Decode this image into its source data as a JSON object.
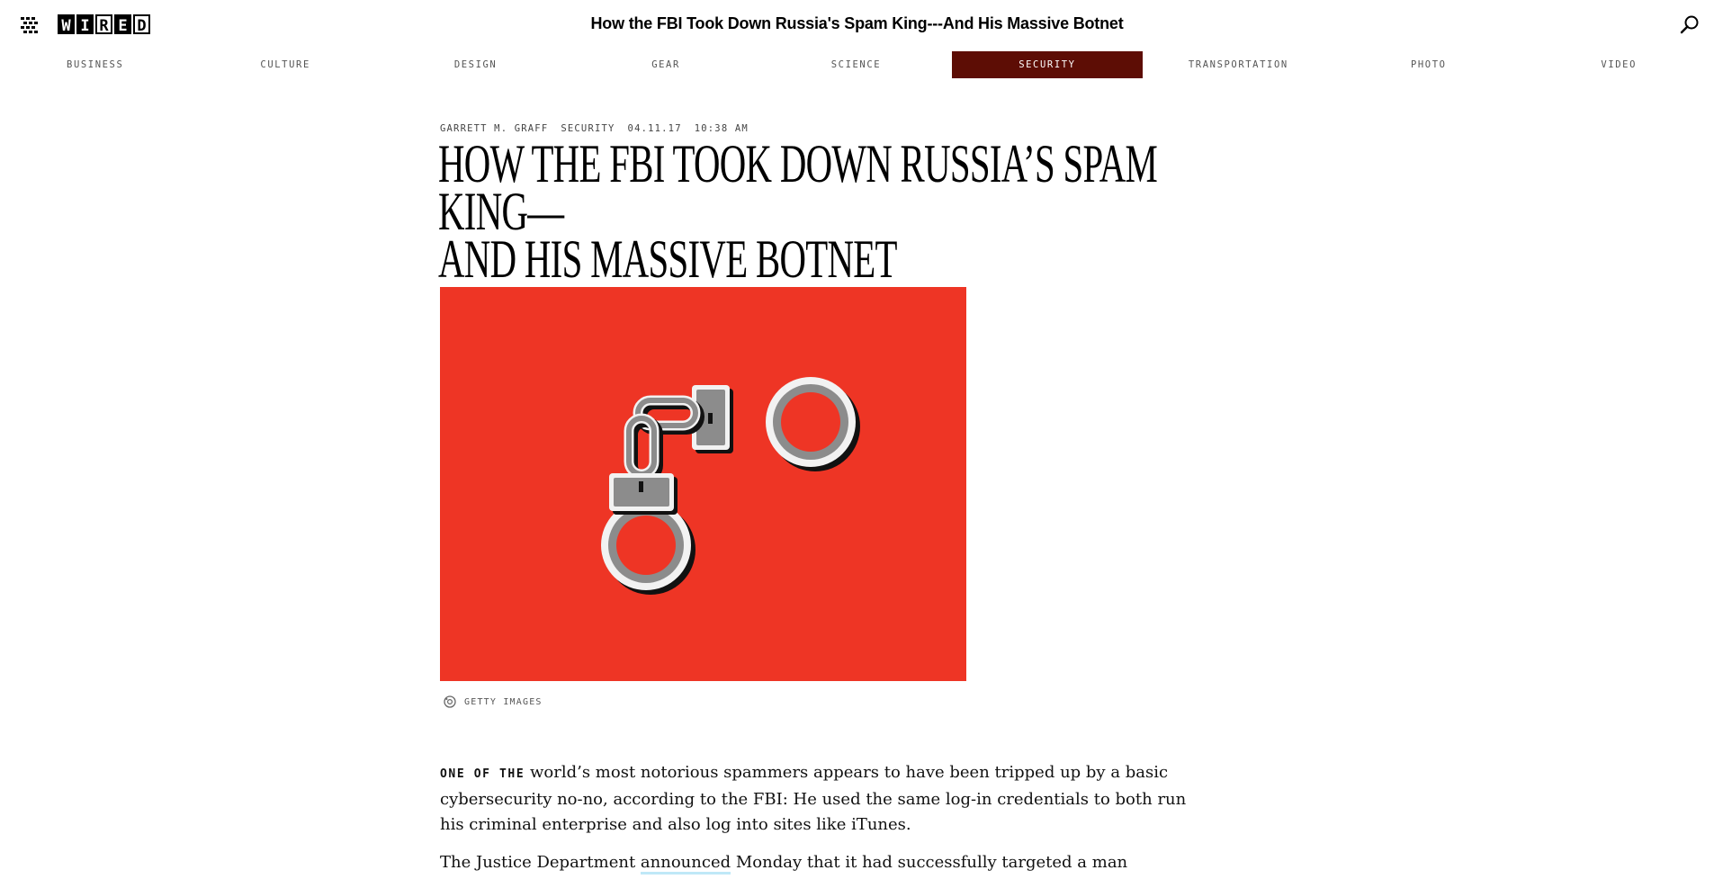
{
  "header": {
    "title": "How the FBI Took Down Russia's Spam King---And His Massive Botnet",
    "logo_letters": [
      "W",
      "I",
      "R",
      "E",
      "D"
    ],
    "menu_icon": "grid-menu-icon",
    "search_icon": "search-icon"
  },
  "nav": {
    "items": [
      {
        "label": "BUSINESS"
      },
      {
        "label": "CULTURE"
      },
      {
        "label": "DESIGN"
      },
      {
        "label": "GEAR"
      },
      {
        "label": "SCIENCE"
      },
      {
        "label": "SECURITY"
      },
      {
        "label": "TRANSPORTATION"
      },
      {
        "label": "PHOTO"
      },
      {
        "label": "VIDEO"
      }
    ],
    "active": "SECURITY",
    "active_color": "#5d0d05"
  },
  "article": {
    "author": "GARRETT M. GRAFF",
    "section": "SECURITY",
    "date": "04.11.17",
    "time": "10:38 AM",
    "headline_line1": "How the FBI Took Down Russia’s Spam King—",
    "headline_line2": "And His Massive Botnet",
    "hero_color": "#ee3525",
    "caption": "GETTY IMAGES",
    "caption_icon": "camera-credit-icon",
    "lead_in": "ONE OF THE",
    "para1_rest": " world’s most notorious spammers appears to have been tripped up by a basic cybersecurity no-no, according to the FBI: He used the same log-in credentials to both run his criminal enterprise and also log into sites like iTunes.",
    "para2_start": "The Justice Department ",
    "para2_link": "announced",
    "para2_rest": " Monday that it had successfully targeted a man"
  }
}
